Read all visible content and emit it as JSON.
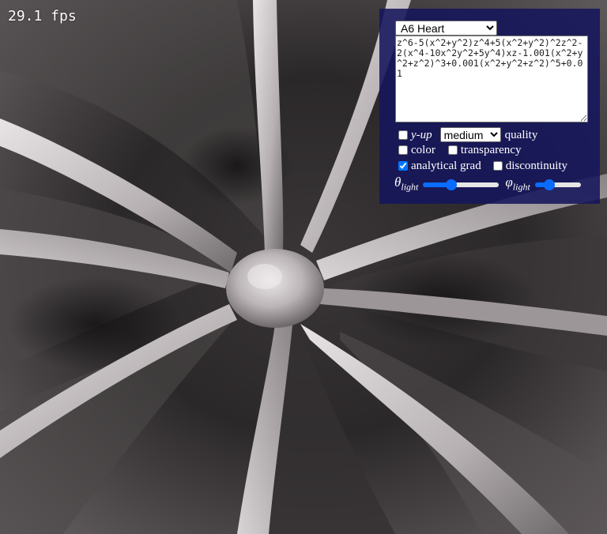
{
  "fps_text": "29.1 fps",
  "controls": {
    "preset": {
      "selected": "A6 Heart"
    },
    "equation": "z^6-5(x^2+y^2)z^4+5(x^2+y^2)^2z^2-2(x^4-10x^2y^2+5y^4)xz-1.001(x^2+y^2+z^2)^3+0.001(x^2+y^2+z^2)^5+0.01",
    "y_up": {
      "label": "y-up",
      "checked": false
    },
    "quality": {
      "selected": "medium",
      "label": "quality"
    },
    "color": {
      "label": "color",
      "checked": false
    },
    "transparency": {
      "label": "transparency",
      "checked": false
    },
    "analytical_grad": {
      "label": "analytical grad",
      "checked": true
    },
    "discontinuity": {
      "label": "discontinuity",
      "checked": false
    },
    "theta_light": {
      "symbol": "θ",
      "sub": "light",
      "value_fraction": 0.35
    },
    "phi_light": {
      "symbol": "φ",
      "sub": "light",
      "value_fraction": 0.25
    }
  },
  "colors": {
    "panel_bg": "#16165c",
    "slider_accent": "#0a6cff",
    "surface": "#c8c2c4"
  }
}
